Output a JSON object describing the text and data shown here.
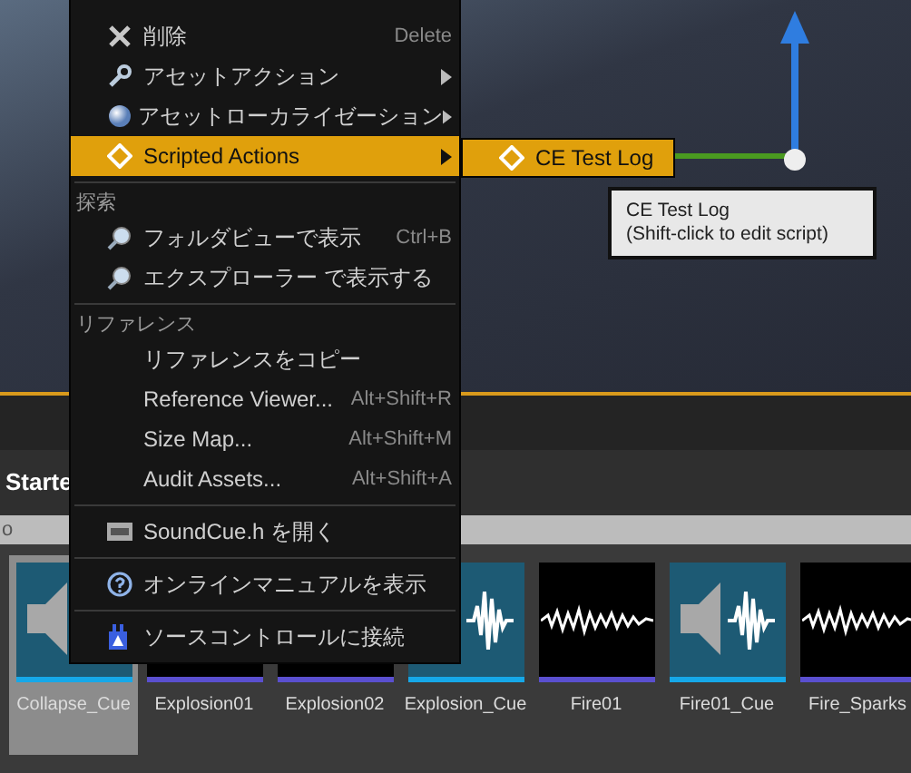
{
  "context_menu": {
    "items": [
      {
        "kind": "item",
        "label": "削除",
        "shortcut": "Delete",
        "submenu": false,
        "selected": false
      },
      {
        "kind": "item",
        "label": "アセットアクション",
        "submenu": true,
        "selected": false
      },
      {
        "kind": "item",
        "label": "アセットローカライゼーション",
        "submenu": true,
        "selected": false
      },
      {
        "kind": "item",
        "label": "Scripted Actions",
        "submenu": true,
        "selected": true
      },
      {
        "kind": "divider"
      },
      {
        "kind": "header",
        "label": "探索"
      },
      {
        "kind": "item",
        "label": "フォルダビューで表示",
        "shortcut": "Ctrl+B",
        "submenu": false,
        "selected": false
      },
      {
        "kind": "item",
        "label": "エクスプローラー で表示する",
        "submenu": false,
        "selected": false
      },
      {
        "kind": "divider"
      },
      {
        "kind": "header",
        "label": "リファレンス"
      },
      {
        "kind": "item",
        "label": "リファレンスをコピー",
        "submenu": false,
        "selected": false
      },
      {
        "kind": "item",
        "label": "Reference Viewer...",
        "shortcut": "Alt+Shift+R",
        "submenu": false,
        "selected": false
      },
      {
        "kind": "item",
        "label": "Size Map...",
        "shortcut": "Alt+Shift+M",
        "submenu": false,
        "selected": false
      },
      {
        "kind": "item",
        "label": "Audit Assets...",
        "shortcut": "Alt+Shift+A",
        "submenu": false,
        "selected": false
      },
      {
        "kind": "divider"
      },
      {
        "kind": "item",
        "label": "SoundCue.h を開く",
        "submenu": false,
        "selected": false
      },
      {
        "kind": "divider"
      },
      {
        "kind": "item",
        "label": "オンラインマニュアルを表示",
        "submenu": false,
        "selected": false
      },
      {
        "kind": "divider"
      },
      {
        "kind": "item",
        "label": "ソースコントロールに接続",
        "submenu": false,
        "selected": false
      }
    ]
  },
  "submenu": {
    "items": [
      {
        "label": "CE Test Log",
        "selected": true
      }
    ]
  },
  "tooltip": {
    "lines": [
      "CE Test Log",
      "(Shift-click to edit script)"
    ]
  },
  "content_browser": {
    "title": "Starte",
    "search": {
      "value": "o"
    },
    "assets": [
      {
        "name": "Collapse_Cue",
        "kind": "cue",
        "selected": true
      },
      {
        "name": "Explosion01",
        "kind": "wave",
        "selected": false
      },
      {
        "name": "Explosion02",
        "kind": "wave",
        "selected": false
      },
      {
        "name": "Explosion_Cue",
        "kind": "cue",
        "selected": false
      },
      {
        "name": "Fire01",
        "kind": "wave",
        "selected": false
      },
      {
        "name": "Fire01_Cue",
        "kind": "cue",
        "selected": false
      },
      {
        "name": "Fire_Sparks",
        "kind": "wave",
        "selected": false
      }
    ]
  }
}
